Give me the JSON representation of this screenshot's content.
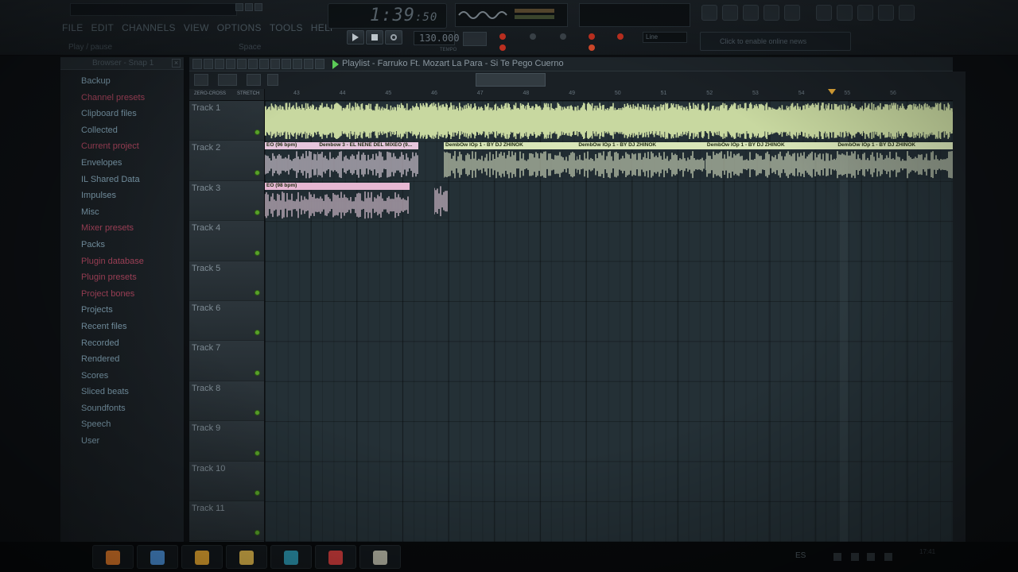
{
  "menu": [
    "FILE",
    "EDIT",
    "CHANNELS",
    "VIEW",
    "OPTIONS",
    "TOOLS",
    "HELP"
  ],
  "hint": {
    "text": "Play / pause",
    "key": "Space"
  },
  "time_display": {
    "main": "1:39",
    "fraction": ":50"
  },
  "tempo": {
    "value": "130.000",
    "label": "TEMPO"
  },
  "line_mode": "Line",
  "news": "Click to enable online news",
  "browser": {
    "title": "Browser - Snap 1",
    "close": "×",
    "items": [
      {
        "label": "Backup",
        "color": "#7b9aab"
      },
      {
        "label": "Channel presets",
        "color": "#a5435b"
      },
      {
        "label": "Clipboard files",
        "color": "#7b9aab"
      },
      {
        "label": "Collected",
        "color": "#7b9aab"
      },
      {
        "label": "Current project",
        "color": "#a5435b"
      },
      {
        "label": "Envelopes",
        "color": "#7b9aab"
      },
      {
        "label": "IL Shared Data",
        "color": "#7b9aab"
      },
      {
        "label": "Impulses",
        "color": "#7b9aab"
      },
      {
        "label": "Misc",
        "color": "#7b9aab"
      },
      {
        "label": "Mixer presets",
        "color": "#a5435b"
      },
      {
        "label": "Packs",
        "color": "#7b9aab"
      },
      {
        "label": "Plugin database",
        "color": "#a5435b"
      },
      {
        "label": "Plugin presets",
        "color": "#a5435b"
      },
      {
        "label": "Project bones",
        "color": "#a5435b"
      },
      {
        "label": "Projects",
        "color": "#7b9aab"
      },
      {
        "label": "Recent files",
        "color": "#7b9aab"
      },
      {
        "label": "Recorded",
        "color": "#7b9aab"
      },
      {
        "label": "Rendered",
        "color": "#7b9aab"
      },
      {
        "label": "Scores",
        "color": "#7b9aab"
      },
      {
        "label": "Sliced beats",
        "color": "#7b9aab"
      },
      {
        "label": "Soundfonts",
        "color": "#7b9aab"
      },
      {
        "label": "Speech",
        "color": "#7b9aab"
      },
      {
        "label": "User",
        "color": "#7b9aab"
      }
    ]
  },
  "playlist": {
    "title": "Playlist - Farruko Ft. Mozart La Para - Si Te Pego Cuerno",
    "options": [
      "ZERO-CROSS",
      "STRETCH"
    ],
    "ruler_ticks": [
      "43",
      "44",
      "45",
      "46",
      "47",
      "48",
      "49",
      "50",
      "51",
      "52",
      "53",
      "54",
      "55",
      "56"
    ],
    "playhead_bar": 54.7,
    "tracks": [
      "Track 1",
      "Track 2",
      "Track 3",
      "Track 4",
      "Track 5",
      "Track 6",
      "Track 7",
      "Track 8",
      "Track 9",
      "Track 10",
      "Track 11"
    ],
    "clips": [
      {
        "track": 0,
        "start": 42.0,
        "end": 57.0,
        "label": "",
        "color": "#d9e6b8",
        "wave": "#c8d8a0"
      },
      {
        "track": 1,
        "start": 42.0,
        "end": 43.15,
        "label": "EO (96 bpm)",
        "color": "#e6c6dd",
        "wave": "#f0e2ee"
      },
      {
        "track": 1,
        "start": 43.15,
        "end": 45.35,
        "label": "Dembow 3 - EL NENE DEL MIXEO (9...",
        "color": "#e6c6dd",
        "wave": "#f0e2ee"
      },
      {
        "track": 1,
        "start": 45.9,
        "end": 48.8,
        "label": "DembOw lOp 1 - BY DJ ZHINOK",
        "color": "#d9e6b8",
        "wave": "#e4edcd"
      },
      {
        "track": 1,
        "start": 48.8,
        "end": 51.6,
        "label": "DembOw lOp 1 - BY DJ ZHINOK",
        "color": "#d9e6b8",
        "wave": "#e4edcd"
      },
      {
        "track": 1,
        "start": 51.6,
        "end": 54.45,
        "label": "DembOw lOp 1 - BY DJ ZHINOK",
        "color": "#d9e6b8",
        "wave": "#e4edcd"
      },
      {
        "track": 1,
        "start": 54.45,
        "end": 57.0,
        "label": "DembOw lOp 1 - BY DJ ZHINOK",
        "color": "#d9e6b8",
        "wave": "#e4edcd"
      },
      {
        "track": 2,
        "start": 42.0,
        "end": 45.15,
        "label": "EO (98 bpm)",
        "color": "#e6b7d2",
        "wave": "#f0d6e6"
      },
      {
        "track": 2,
        "start": 45.7,
        "end": 46.0,
        "label": "",
        "color": "#e6b7d2",
        "wave": "#f0d6e6"
      }
    ]
  },
  "taskbar": {
    "lang": "ES",
    "clock": "17:41",
    "apps": [
      {
        "name": "media-player-icon",
        "color": "#e07a2a"
      },
      {
        "name": "chrome-icon",
        "color": "#4a8fd6"
      },
      {
        "name": "fl-studio-icon",
        "color": "#e0a330"
      },
      {
        "name": "file-explorer-icon",
        "color": "#d8b24a"
      },
      {
        "name": "audition-icon",
        "color": "#2a8fa8"
      },
      {
        "name": "flash-icon",
        "color": "#c83a3a"
      },
      {
        "name": "fl-99-icon",
        "color": "#b0b0a0"
      }
    ]
  }
}
